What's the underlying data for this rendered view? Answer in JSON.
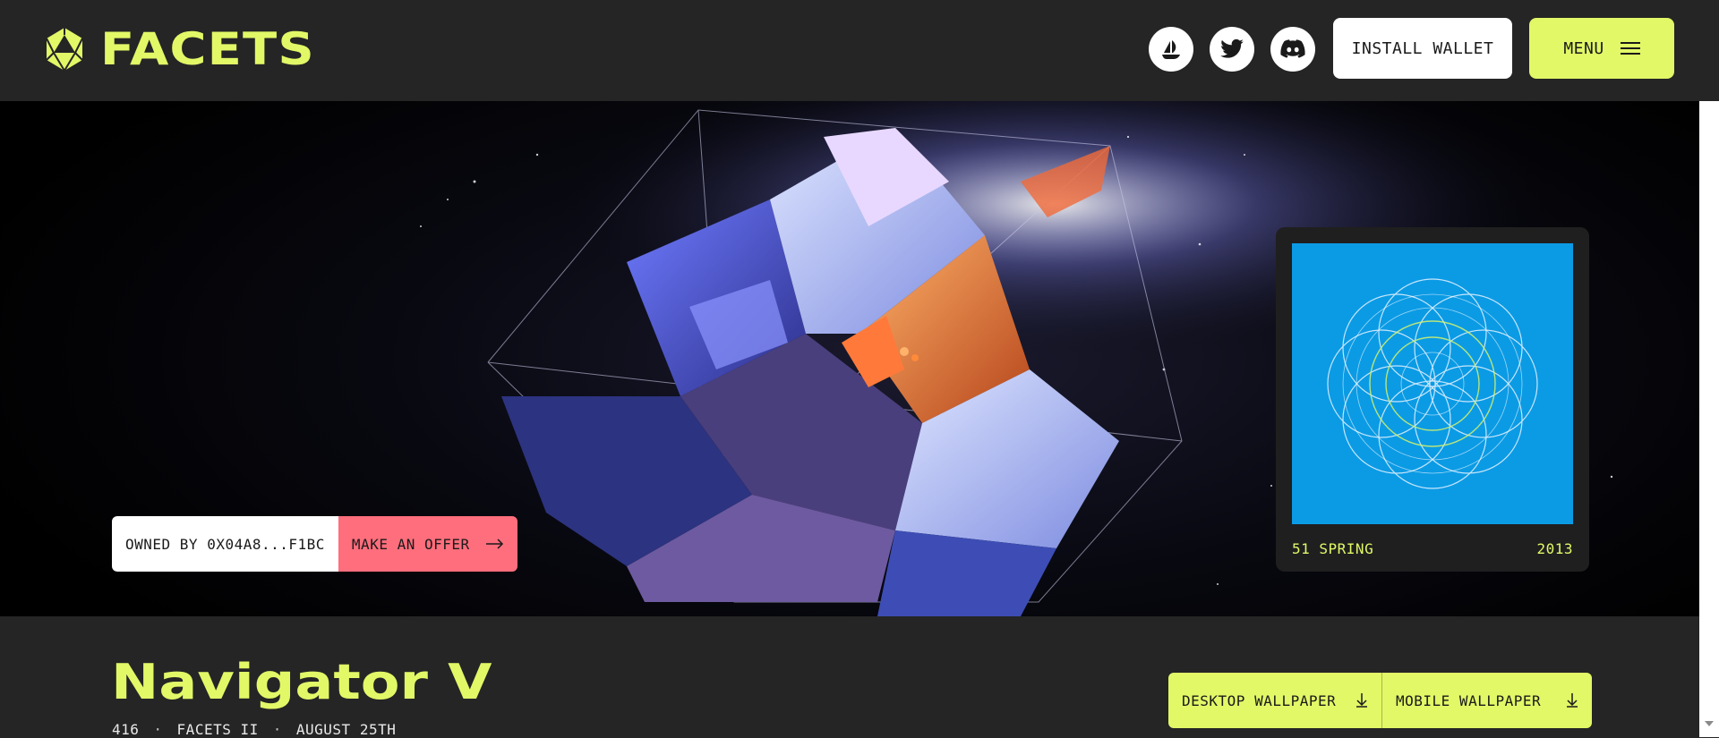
{
  "header": {
    "logo_text": "FACETS",
    "social_icons": [
      "opensea-icon",
      "twitter-icon",
      "discord-icon"
    ],
    "install_wallet_label": "INSTALL WALLET",
    "menu_label": "MENU"
  },
  "hero": {
    "owned_label": "OWNED BY 0X04A8...F1BC",
    "offer_label": "MAKE AN OFFER"
  },
  "card": {
    "name": "51 SPRING",
    "year": "2013"
  },
  "artwork": {
    "title": "Navigator V",
    "meta": [
      "416",
      "FACETS II",
      "AUGUST 25TH"
    ],
    "meta_separator": "·"
  },
  "downloads": {
    "desktop_label": "DESKTOP WALLPAPER",
    "mobile_label": "MOBILE WALLPAPER"
  },
  "colors": {
    "accent": "#e2f867",
    "background": "#252525",
    "offer": "#ff6e7c",
    "card_blue": "#0b9be5"
  }
}
